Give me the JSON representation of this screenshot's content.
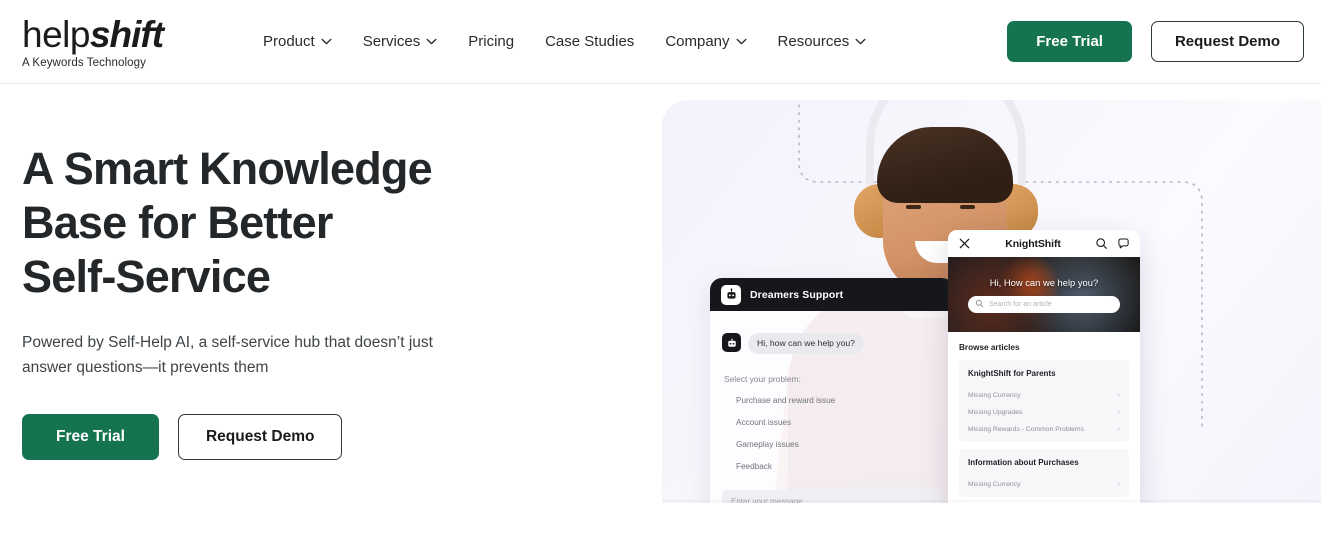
{
  "brand": {
    "word_light": "help",
    "word_bold": "shift",
    "tagline": "A Keywords Technology"
  },
  "header": {
    "nav": [
      {
        "label": "Product",
        "has_dropdown": true,
        "icon": "chevron-down-icon"
      },
      {
        "label": "Services",
        "has_dropdown": true,
        "icon": "chevron-down-icon"
      },
      {
        "label": "Pricing",
        "has_dropdown": false
      },
      {
        "label": "Case Studies",
        "has_dropdown": false
      },
      {
        "label": "Company",
        "has_dropdown": true,
        "icon": "chevron-down-icon"
      },
      {
        "label": "Resources",
        "has_dropdown": true,
        "icon": "chevron-down-icon"
      }
    ],
    "cta_primary": "Free Trial",
    "cta_secondary": "Request Demo"
  },
  "hero": {
    "title_line1": "A Smart Knowledge",
    "title_line2": "Base for Better",
    "title_line3": "Self-Service",
    "subtitle": "Powered by Self-Help AI, a self-service hub that doesn’t just answer questions—it prevents them",
    "cta_primary": "Free Trial",
    "cta_secondary": "Request Demo"
  },
  "chat_widget": {
    "header_title": "Dreamers Support",
    "header_icon": "bot-icon",
    "bot_message": "Hi, how can we help you?",
    "prompt": "Select your problem:",
    "options": [
      "Purchase and reward issue",
      "Account issues",
      "Gameplay issues",
      "Feedback"
    ],
    "input_placeholder": "Enter your message"
  },
  "knowledge_panel": {
    "title": "KnightShift",
    "close_icon": "close-icon",
    "search_icon": "search-icon",
    "chat_icon": "chat-bubble-icon",
    "hero_heading": "Hi, How can we help you?",
    "hero_search_placeholder": "Search for an article",
    "browse_label": "Browse articles",
    "groups": [
      {
        "title": "KnightShift for Parents",
        "items": [
          "Missing Currency",
          "Missing Upgrades",
          "Missing Rewards - Common Problems"
        ]
      },
      {
        "title": "Information about Purchases",
        "items": [
          "Missing Currency"
        ]
      }
    ],
    "row_arrow": "›"
  },
  "colors": {
    "brand_green": "#15744f",
    "text_dark": "#23272a",
    "hero_bg": "#f5f4fb"
  }
}
